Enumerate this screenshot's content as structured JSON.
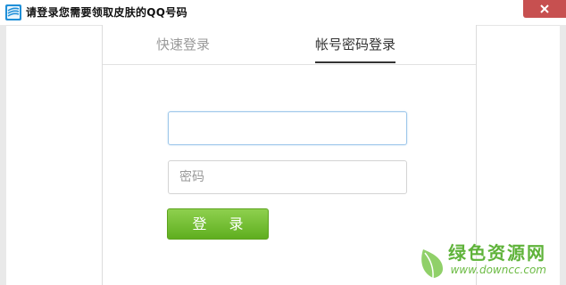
{
  "window": {
    "title": "请登录您需要领取皮肤的QQ号码",
    "icons": {
      "app": "app-logo-icon",
      "close": "close-icon"
    },
    "close_button_color": "#c75050"
  },
  "login": {
    "tabs": [
      {
        "label": "快速登录",
        "active": false
      },
      {
        "label": "帐号密码登录",
        "active": true
      }
    ],
    "account_field": {
      "value": "",
      "placeholder": ""
    },
    "password_field": {
      "value": "",
      "placeholder": "密码"
    },
    "submit_label": "登 录",
    "accent_color": "#6cbf2c"
  },
  "watermark": {
    "title": "绿色资源网",
    "url": "www.downcc.com",
    "icon": "leaf-logo-icon"
  }
}
